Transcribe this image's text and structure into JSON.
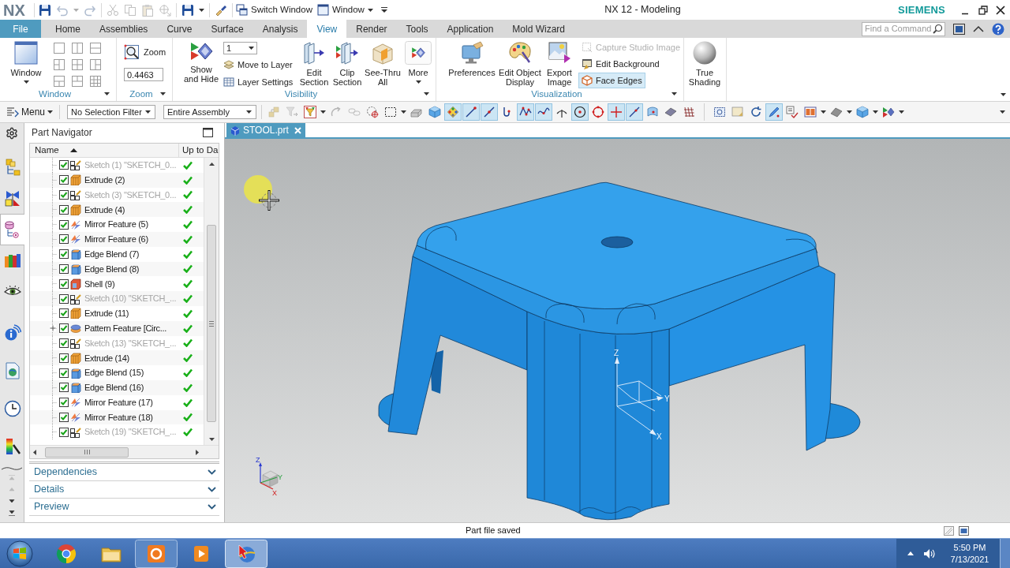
{
  "title_bar": {
    "logo": "NX",
    "quick_access": [
      [
        {
          "kind": "save",
          "disabled": false
        },
        {
          "kind": "undo",
          "disabled": true
        },
        {
          "kind": "caret",
          "disabled": true
        },
        {
          "kind": "redo",
          "disabled": true
        }
      ],
      [
        {
          "kind": "cut",
          "disabled": true
        },
        {
          "kind": "copy",
          "disabled": true
        },
        {
          "kind": "paste",
          "disabled": true
        },
        {
          "kind": "transform",
          "disabled": true
        }
      ],
      [
        {
          "kind": "save",
          "disabled": false
        },
        {
          "kind": "caret",
          "disabled": false
        }
      ],
      [
        {
          "kind": "brush",
          "disabled": false
        }
      ]
    ],
    "switch_window": "Switch Window",
    "window_menu": "Window",
    "title": "NX 12 - Modeling",
    "brand": "SIEMENS"
  },
  "ribbon": {
    "tabs": [
      {
        "label": "File",
        "kind": "file",
        "selected": false
      },
      {
        "label": "Home",
        "kind": "tab",
        "selected": false
      },
      {
        "label": "Assemblies",
        "kind": "tab",
        "selected": false
      },
      {
        "label": "Curve",
        "kind": "tab",
        "selected": false
      },
      {
        "label": "Surface",
        "kind": "tab",
        "selected": false
      },
      {
        "label": "Analysis",
        "kind": "tab",
        "selected": false
      },
      {
        "label": "View",
        "kind": "tab",
        "selected": true
      },
      {
        "label": "Render",
        "kind": "tab",
        "selected": false
      },
      {
        "label": "Tools",
        "kind": "tab",
        "selected": false
      },
      {
        "label": "Application",
        "kind": "tab",
        "selected": false
      },
      {
        "label": "Mold Wizard",
        "kind": "tab",
        "selected": false
      }
    ],
    "command_finder": {
      "placeholder": "Find a Command"
    },
    "groups": [
      {
        "kind": "window",
        "title": "Window",
        "button": "Window",
        "layouts": [
          {
            "kind": "single"
          },
          {
            "kind": "cols"
          },
          {
            "kind": "rows"
          },
          {
            "kind": "left-split"
          },
          {
            "kind": "quad"
          },
          {
            "kind": "right-split"
          },
          {
            "kind": "bottom-split"
          },
          {
            "kind": "top-split"
          },
          {
            "kind": "grid"
          }
        ]
      },
      {
        "kind": "zoom",
        "title": "Zoom",
        "button": "Zoom",
        "scale": "0.4463"
      },
      {
        "kind": "visibility",
        "title": "Visibility",
        "show_hide": "Show\nand Hide",
        "layer": "1",
        "layer_commands": [
          {
            "kind": "move",
            "label": "Move to Layer"
          },
          {
            "kind": "settings",
            "label": "Layer Settings"
          }
        ],
        "sections": [
          {
            "kind": "edit-section",
            "label": "Edit\nSection"
          },
          {
            "kind": "clip-section",
            "label": "Clip\nSection"
          },
          {
            "kind": "see-thru",
            "label": "See-Thru\nAll"
          }
        ],
        "more": "More"
      },
      {
        "kind": "visualization",
        "title": "Visualization",
        "commands": [
          {
            "kind": "preferences",
            "label": "Preferences"
          },
          {
            "kind": "object-display",
            "label": "Edit Object\nDisplay"
          },
          {
            "kind": "export-image",
            "label": "Export\nImage"
          }
        ],
        "toggles": [
          {
            "kind": "capture",
            "label": "Capture Studio Image",
            "disabled": true,
            "selected": false
          },
          {
            "kind": "background",
            "label": "Edit Background",
            "disabled": false,
            "selected": false
          },
          {
            "kind": "face-edges",
            "label": "Face Edges",
            "disabled": false,
            "selected": true
          }
        ]
      },
      {
        "kind": "shading",
        "button": "True\nShading"
      }
    ]
  },
  "selection_bar": {
    "menu": "Menu",
    "filter": "No Selection Filter",
    "scope": "Entire Assembly",
    "tool_groups": [
      [
        {
          "kind": "assembly",
          "selected": false,
          "disabled": true
        },
        {
          "kind": "arrow-filter",
          "selected": false,
          "disabled": true
        },
        {
          "kind": "type-filter",
          "selected": false,
          "disabled": false
        },
        {
          "kind": "caret",
          "disabled": false
        },
        {
          "kind": "rotate-snap",
          "selected": false,
          "disabled": true
        },
        {
          "kind": "chain",
          "selected": false,
          "disabled": true
        },
        {
          "kind": "target",
          "selected": false,
          "disabled": false
        },
        {
          "kind": "rect-select",
          "selected": false,
          "disabled": false
        },
        {
          "kind": "caret",
          "disabled": false
        },
        {
          "kind": "solid",
          "selected": false,
          "disabled": false
        },
        {
          "kind": "cube",
          "selected": false,
          "disabled": false
        },
        {
          "kind": "snap-grid",
          "selected": true,
          "disabled": false
        },
        {
          "kind": "end-point",
          "selected": true,
          "disabled": false
        },
        {
          "kind": "mid-point",
          "selected": true,
          "disabled": false
        },
        {
          "kind": "hook",
          "selected": false,
          "disabled": false
        },
        {
          "kind": "poly",
          "selected": true,
          "disabled": false
        },
        {
          "kind": "spline",
          "selected": true,
          "disabled": false
        },
        {
          "kind": "perpendicular",
          "selected": false,
          "disabled": false
        },
        {
          "kind": "center",
          "selected": true,
          "disabled": false
        },
        {
          "kind": "quadrant",
          "selected": false,
          "disabled": false
        },
        {
          "kind": "cross",
          "selected": true,
          "disabled": false
        },
        {
          "kind": "line-point",
          "selected": true,
          "disabled": false
        },
        {
          "kind": "face-point",
          "selected": false,
          "disabled": false
        },
        {
          "kind": "plane",
          "selected": false,
          "disabled": false
        },
        {
          "kind": "grid",
          "selected": false,
          "disabled": false
        }
      ],
      [
        {
          "kind": "fit",
          "selected": false,
          "disabled": false
        },
        {
          "kind": "image",
          "selected": false,
          "disabled": false
        },
        {
          "kind": "rotate",
          "selected": false,
          "disabled": false
        },
        {
          "kind": "pen",
          "selected": true,
          "disabled": false
        },
        {
          "kind": "layers",
          "selected": false,
          "disabled": false
        },
        {
          "kind": "panels",
          "selected": false,
          "disabled": false
        },
        {
          "kind": "caret",
          "disabled": false
        },
        {
          "kind": "wedge",
          "selected": false,
          "disabled": false
        },
        {
          "kind": "caret",
          "disabled": false
        },
        {
          "kind": "cube",
          "selected": false,
          "disabled": false
        },
        {
          "kind": "caret",
          "disabled": false
        },
        {
          "kind": "show-hide",
          "selected": false,
          "disabled": false
        },
        {
          "kind": "caret",
          "disabled": false
        }
      ]
    ]
  },
  "resource_bar": {
    "navigators": [
      {
        "kind": "assembly",
        "selected": false
      },
      {
        "kind": "constraints",
        "selected": false
      },
      {
        "kind": "part",
        "selected": true
      },
      {
        "kind": "library",
        "selected": false
      },
      {
        "kind": "visibility",
        "selected": false
      }
    ],
    "tools": [
      {
        "kind": "info",
        "selected": false
      },
      {
        "kind": "web",
        "selected": false
      },
      {
        "kind": "history",
        "selected": false
      },
      {
        "kind": "palette",
        "selected": false
      }
    ],
    "scroll_buttons": [
      {
        "kind": "first",
        "disabled": true
      },
      {
        "kind": "up",
        "disabled": true
      },
      {
        "kind": "down",
        "disabled": false
      },
      {
        "kind": "last",
        "disabled": false
      }
    ]
  },
  "part_navigator": {
    "title": "Part Navigator",
    "columns": [
      {
        "label": "Name",
        "sorted": true
      },
      {
        "label": "Up to Da",
        "sorted": false
      }
    ],
    "rows": [
      {
        "label": "Sketch (1) \"SKETCH_0...",
        "kind": "sketch",
        "checked": true,
        "greyed": true,
        "collapsed": false,
        "up_to_date": true
      },
      {
        "label": "Extrude (2)",
        "kind": "extrude",
        "checked": true,
        "greyed": false,
        "collapsed": false,
        "up_to_date": true
      },
      {
        "label": "Sketch (3) \"SKETCH_0...",
        "kind": "sketch",
        "checked": true,
        "greyed": true,
        "collapsed": false,
        "up_to_date": true
      },
      {
        "label": "Extrude (4)",
        "kind": "extrude",
        "checked": true,
        "greyed": false,
        "collapsed": false,
        "up_to_date": true
      },
      {
        "label": "Mirror Feature (5)",
        "kind": "mirror",
        "checked": true,
        "greyed": false,
        "collapsed": false,
        "up_to_date": true
      },
      {
        "label": "Mirror Feature (6)",
        "kind": "mirror",
        "checked": true,
        "greyed": false,
        "collapsed": false,
        "up_to_date": true
      },
      {
        "label": "Edge Blend (7)",
        "kind": "blend",
        "checked": true,
        "greyed": false,
        "collapsed": false,
        "up_to_date": true
      },
      {
        "label": "Edge Blend (8)",
        "kind": "blend",
        "checked": true,
        "greyed": false,
        "collapsed": false,
        "up_to_date": true
      },
      {
        "label": "Shell (9)",
        "kind": "shell",
        "checked": true,
        "greyed": false,
        "collapsed": false,
        "up_to_date": true
      },
      {
        "label": "Sketch (10) \"SKETCH_...",
        "kind": "sketch",
        "checked": true,
        "greyed": true,
        "collapsed": false,
        "up_to_date": true
      },
      {
        "label": "Extrude (11)",
        "kind": "extrude",
        "checked": true,
        "greyed": false,
        "collapsed": false,
        "up_to_date": true
      },
      {
        "label": "Pattern Feature [Circ...",
        "kind": "pattern",
        "checked": true,
        "greyed": false,
        "collapsed": true,
        "up_to_date": true
      },
      {
        "label": "Sketch (13) \"SKETCH_...",
        "kind": "sketch",
        "checked": true,
        "greyed": true,
        "collapsed": false,
        "up_to_date": true
      },
      {
        "label": "Extrude (14)",
        "kind": "extrude",
        "checked": true,
        "greyed": false,
        "collapsed": false,
        "up_to_date": true
      },
      {
        "label": "Edge Blend (15)",
        "kind": "blend",
        "checked": true,
        "greyed": false,
        "collapsed": false,
        "up_to_date": true
      },
      {
        "label": "Edge Blend (16)",
        "kind": "blend",
        "checked": true,
        "greyed": false,
        "collapsed": false,
        "up_to_date": true
      },
      {
        "label": "Mirror Feature (17)",
        "kind": "mirror",
        "checked": true,
        "greyed": false,
        "collapsed": false,
        "up_to_date": true
      },
      {
        "label": "Mirror Feature (18)",
        "kind": "mirror",
        "checked": true,
        "greyed": false,
        "collapsed": false,
        "up_to_date": true
      },
      {
        "label": "Sketch (19) \"SKETCH_...",
        "kind": "sketch",
        "checked": true,
        "greyed": true,
        "collapsed": false,
        "up_to_date": true
      }
    ],
    "sections": [
      {
        "label": "Dependencies",
        "expanded": false
      },
      {
        "label": "Details",
        "expanded": false
      },
      {
        "label": "Preview",
        "expanded": false
      }
    ]
  },
  "graphics": {
    "tabs": [
      {
        "label": "STOOL.prt",
        "selected": true
      }
    ],
    "wcs_axes": {
      "z": "Z",
      "y": "Y",
      "x": "X"
    },
    "view_axes": {
      "z": "Z",
      "y": "Y",
      "x": "X"
    }
  },
  "status_bar": {
    "message": "Part file saved"
  },
  "taskbar": {
    "apps": [
      {
        "kind": "browser",
        "running": false,
        "selected": false
      },
      {
        "kind": "folder",
        "running": false,
        "selected": false
      },
      {
        "kind": "recorder",
        "running": true,
        "selected": false
      },
      {
        "kind": "media",
        "running": false,
        "selected": false
      },
      {
        "kind": "cad",
        "running": true,
        "selected": true
      }
    ],
    "time": "5:50 PM",
    "date": "7/13/2021"
  }
}
